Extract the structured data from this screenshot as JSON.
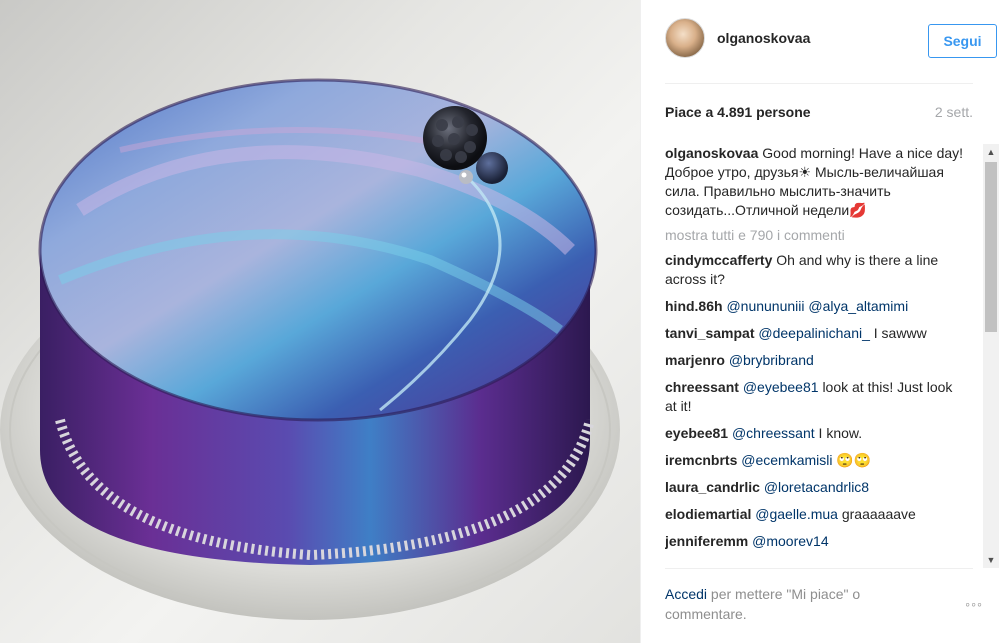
{
  "post": {
    "username": "olganoskovaa",
    "follow_label": "Segui",
    "likes_text": "Piace a 4.891 persone",
    "time_ago": "2 sett.",
    "caption": {
      "user": "olganoskovaa",
      "text": "Good morning! Have a nice day! Доброе утро, друзья☀ Мысль-величайшая сила. Правильно мыслить-значить созидать...Отличной недели💋"
    },
    "show_all_comments": "mostra tutti e 790 i commenti",
    "comments": [
      {
        "user": "cindymccafferty",
        "mention": "",
        "text": "Oh and why is there a line across it?"
      },
      {
        "user": "hind.86h",
        "mention": "@nunununiii @alya_altamimi",
        "text": ""
      },
      {
        "user": "tanvi_sampat",
        "mention": "@deepalinichani_",
        "text": "I sawww"
      },
      {
        "user": "marjenro",
        "mention": "@brybribrand",
        "text": ""
      },
      {
        "user": "chreessant",
        "mention": "@eyebee81",
        "text": "look at this! Just look at it!"
      },
      {
        "user": "eyebee81",
        "mention": "@chreessant",
        "text": "I know."
      },
      {
        "user": "iremcnbrts",
        "mention": "@ecemkamisli",
        "text": "🙄🙄"
      },
      {
        "user": "laura_candrlic",
        "mention": "@loretacandrlic8",
        "text": ""
      },
      {
        "user": "elodiemartial",
        "mention": "@gaelle.mua",
        "text": "graaaaaave"
      },
      {
        "user": "jenniferemm",
        "mention": "@moorev14",
        "text": ""
      }
    ],
    "footer": {
      "login_label": "Accedi",
      "rest_text": "per mettere \"Mi piace\" o commentare."
    },
    "options_glyph": "◦◦◦",
    "options_icon": "more-options-icon",
    "scroll_up_glyph": "▲",
    "scroll_down_glyph": "▼",
    "colors": {
      "link_blue": "#3897f0",
      "mention_blue": "#003569",
      "muted_gray": "#a5a7aa"
    }
  }
}
